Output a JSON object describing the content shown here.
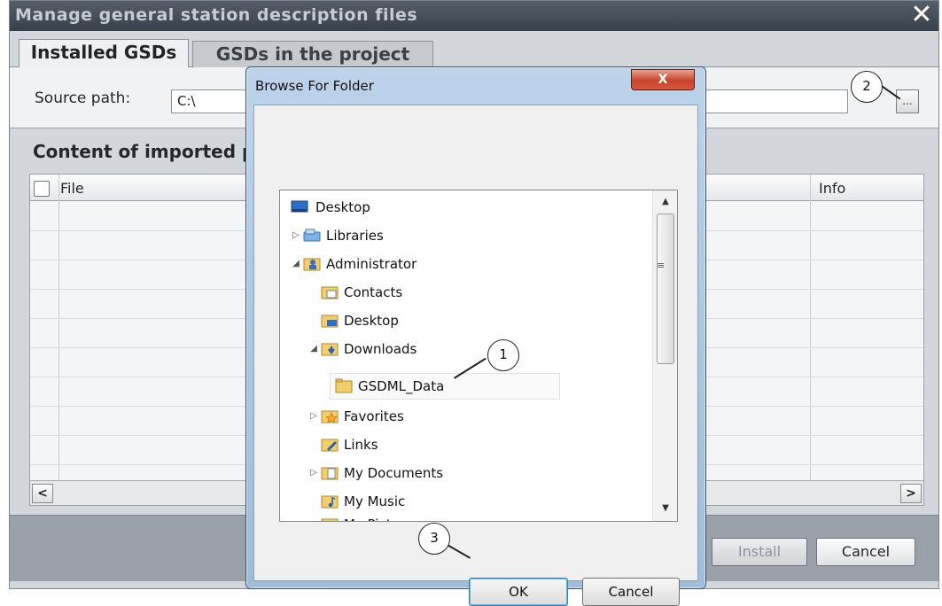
{
  "main_window": {
    "title": "Manage general station description files",
    "close_glyph": "✕",
    "tabs": [
      {
        "label": "Installed GSDs",
        "active": true
      },
      {
        "label": "GSDs in the project",
        "active": false
      }
    ],
    "source_path": {
      "label": "Source path:",
      "value": "C:\\"
    },
    "browse_button_label": "...",
    "content_heading": "Content of imported pa",
    "table": {
      "columns": [
        "File",
        "Info"
      ],
      "rows": []
    },
    "buttons": {
      "install": "Install",
      "cancel": "Cancel"
    }
  },
  "browse_dialog": {
    "title": "Browse For Folder",
    "close_glyph": "X",
    "tree": [
      {
        "label": "Desktop",
        "icon": "desktop-icon"
      },
      {
        "label": "Libraries",
        "icon": "libraries-icon",
        "expander": "▷"
      },
      {
        "label": "Administrator",
        "icon": "user-folder-icon",
        "expander": "◢"
      },
      {
        "label": "Contacts",
        "icon": "contacts-folder-icon"
      },
      {
        "label": "Desktop",
        "icon": "desktop-folder-icon"
      },
      {
        "label": "Downloads",
        "icon": "downloads-folder-icon",
        "expander": "◢"
      },
      {
        "label": "GSDML_Data",
        "icon": "folder-icon",
        "selected": true
      },
      {
        "label": "Favorites",
        "icon": "favorites-folder-icon",
        "expander": "▷"
      },
      {
        "label": "Links",
        "icon": "links-folder-icon"
      },
      {
        "label": "My Documents",
        "icon": "documents-folder-icon",
        "expander": "▷"
      },
      {
        "label": "My Music",
        "icon": "music-folder-icon"
      },
      {
        "label": "My Pictures",
        "icon": "pictures-folder-icon"
      }
    ],
    "scroll_glyphs": {
      "up": "▲",
      "down": "▼",
      "grip": "≡"
    },
    "buttons": {
      "ok": "OK",
      "cancel": "Cancel"
    }
  },
  "callouts": [
    "1",
    "2",
    "3"
  ],
  "colors": {
    "titlebar": "#38414a",
    "dialog_frame": "#bcd3ea",
    "close_red": "#c6442c",
    "ok_focus": "#66b7e8"
  }
}
